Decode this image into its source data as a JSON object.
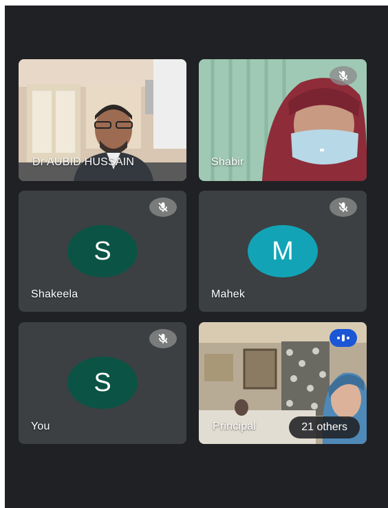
{
  "meet": {
    "tiles": [
      {
        "name": "Dr AUBID HUSSAIN",
        "type": "video",
        "muted": false
      },
      {
        "name": "Shabir",
        "type": "video",
        "muted": true,
        "mute_icon": "mic-off-icon"
      },
      {
        "name": "Shakeela",
        "type": "avatar",
        "initial": "S",
        "avatar_color": "#0b5345",
        "muted": true,
        "mute_icon": "mic-off-icon"
      },
      {
        "name": "Mahek",
        "type": "avatar",
        "initial": "M",
        "avatar_color": "#12a4b6",
        "muted": true,
        "mute_icon": "mic-off-icon"
      },
      {
        "name": "You",
        "type": "avatar",
        "initial": "S",
        "avatar_color": "#0b5345",
        "muted": true,
        "mute_icon": "mic-off-icon"
      },
      {
        "name": "Principal",
        "type": "video",
        "speaking": true,
        "speaking_icon": "audio-indicator-icon",
        "others_label": "21 others"
      }
    ]
  },
  "colors": {
    "background": "#202124",
    "tile": "#3c4043",
    "speaking_blue": "#1a56d6"
  }
}
